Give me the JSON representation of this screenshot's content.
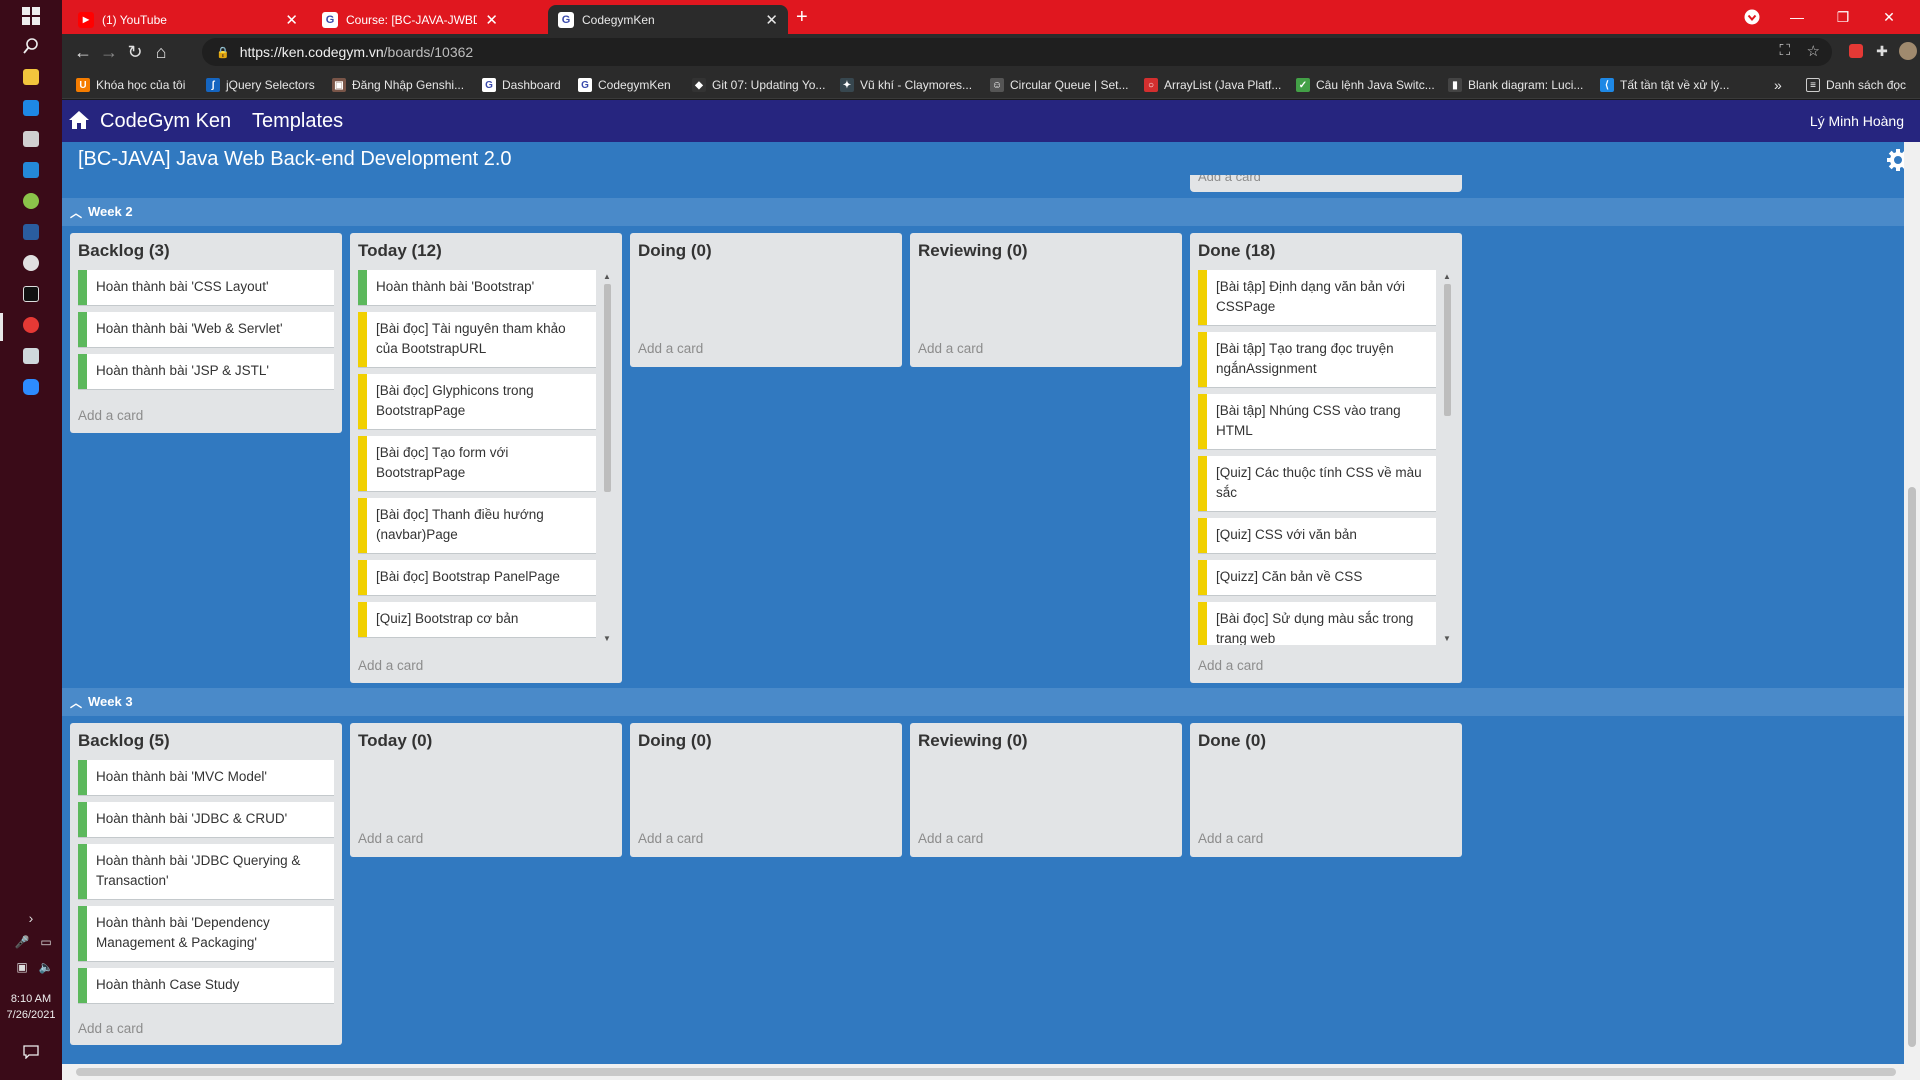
{
  "taskbar": {
    "clock_time": "8:10 AM",
    "clock_date": "7/26/2021"
  },
  "browser": {
    "tabs": [
      {
        "title": "(1) YouTube"
      },
      {
        "title": "Course: [BC-JAVA-JWBD] Java We"
      },
      {
        "title": "CodegymKen"
      }
    ],
    "url_host": "https://ken.codegym.vn",
    "url_path": "/boards/10362",
    "bookmarks": [
      "Khóa học của tôi",
      "jQuery Selectors",
      "Đăng Nhập Genshi...",
      "Dashboard",
      "CodegymKen",
      "Git 07: Updating Yo...",
      "Vũ khí - Claymores...",
      "Circular Queue | Set...",
      "ArrayList (Java Platf...",
      "Câu lệnh Java Switc...",
      "Blank diagram: Luci...",
      "Tất tần tật về xử lý..."
    ],
    "bookmarks_more": "»",
    "reading_list": "Danh sách đọc"
  },
  "app": {
    "brand": "CodeGym Ken",
    "templates": "Templates",
    "user": "Lý Minh Hoàng",
    "board_title": "[BC-JAVA] Java Web Back-end Development 2.0",
    "add_card": "Add a card",
    "weeks": [
      {
        "label": "Week 2",
        "lists": [
          {
            "title": "Backlog (3)",
            "cards": [
              "Hoàn thành bài 'CSS Layout'",
              "Hoàn thành bài 'Web & Servlet'",
              "Hoàn thành bài 'JSP & JSTL'"
            ]
          },
          {
            "title": "Today (12)",
            "cards": [
              "Hoàn thành bài 'Bootstrap'",
              "[Bài đọc] Tài nguyên tham khảo của BootstrapURL",
              "[Bài đọc] Glyphicons trong BootstrapPage",
              "[Bài đọc] Tạo form với BootstrapPage",
              "[Bài đọc] Thanh điều hướng (navbar)Page",
              "[Bài đọc] Bootstrap PanelPage",
              "[Quiz] Bootstrap cơ bản"
            ]
          },
          {
            "title": "Doing (0)",
            "cards": []
          },
          {
            "title": "Reviewing (0)",
            "cards": []
          },
          {
            "title": "Done (18)",
            "cards": [
              "[Bài tập] Định dạng văn bản với CSSPage",
              "[Bài tập] Tạo trang đọc truyện ngắnAssignment",
              "[Bài tập] Nhúng CSS vào trang HTML",
              "[Quiz] Các thuộc tính CSS về màu sắc",
              "[Quiz] CSS với văn bản",
              "[Quizz] Căn bản về CSS",
              "[Bài đọc] Sử dụng màu sắc trong trang web"
            ]
          }
        ]
      },
      {
        "label": "Week 3",
        "lists": [
          {
            "title": "Backlog (5)",
            "cards": [
              "Hoàn thành bài 'MVC Model'",
              "Hoàn thành bài 'JDBC & CRUD'",
              "Hoàn thành bài 'JDBC Querying & Transaction'",
              "Hoàn thành bài 'Dependency Management & Packaging'",
              "Hoàn thành Case Study"
            ]
          },
          {
            "title": "Today (0)",
            "cards": []
          },
          {
            "title": "Doing (0)",
            "cards": []
          },
          {
            "title": "Reviewing (0)",
            "cards": []
          },
          {
            "title": "Done (0)",
            "cards": []
          }
        ]
      }
    ]
  },
  "colors": {
    "tabstrip": "#e0171f",
    "navbar": "#26257f",
    "board_bg": "#3179c0",
    "green_label": "#5cb85c",
    "yellow_label": "#f1d000"
  }
}
